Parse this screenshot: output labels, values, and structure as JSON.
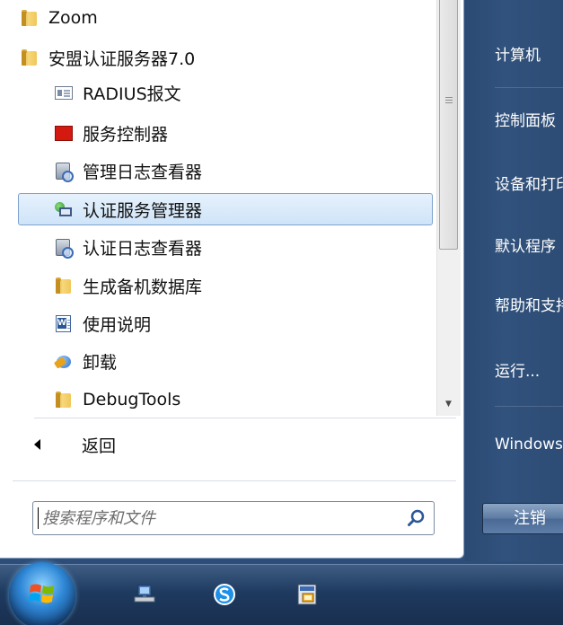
{
  "programs": [
    {
      "label": "Zoom",
      "icon": "folder-icon",
      "level": 0,
      "selected": false
    },
    {
      "label": "安盟认证服务器7.0",
      "icon": "folder-icon",
      "level": 0,
      "selected": false
    },
    {
      "label": "RADIUS报文",
      "icon": "document-window-icon",
      "level": 1,
      "selected": false
    },
    {
      "label": "服务控制器",
      "icon": "service-controller-icon",
      "level": 1,
      "selected": false
    },
    {
      "label": "管理日志查看器",
      "icon": "log-viewer-icon",
      "level": 1,
      "selected": false
    },
    {
      "label": "认证服务管理器",
      "icon": "server-manager-icon",
      "level": 1,
      "selected": true
    },
    {
      "label": "认证日志查看器",
      "icon": "log-viewer-icon",
      "level": 1,
      "selected": false
    },
    {
      "label": "生成备机数据库",
      "icon": "folder-icon",
      "level": 1,
      "selected": false
    },
    {
      "label": "使用说明",
      "icon": "word-document-icon",
      "level": 1,
      "selected": false
    },
    {
      "label": "卸载",
      "icon": "uninstall-icon",
      "level": 1,
      "selected": false
    },
    {
      "label": "DebugTools",
      "icon": "folder-icon",
      "level": 1,
      "selected": false
    }
  ],
  "back": {
    "label": "返回"
  },
  "search": {
    "placeholder": "搜索程序和文件"
  },
  "right_menu": {
    "items": [
      "计算机",
      "控制面板",
      "设备和打印机",
      "默认程序",
      "帮助和支持",
      "运行...",
      "Windows 安全"
    ]
  },
  "power": {
    "label": "注销"
  },
  "colors": {
    "selection_bg": "#dbeafb",
    "selection_border": "#7da2ce",
    "right_pane": "#2e4d78",
    "taskbar": "#1e3a5f"
  },
  "taskbar": {
    "icons": [
      "start-orb-icon",
      "network-computer-icon",
      "sogou-input-icon",
      "remote-desktop-icon"
    ]
  }
}
